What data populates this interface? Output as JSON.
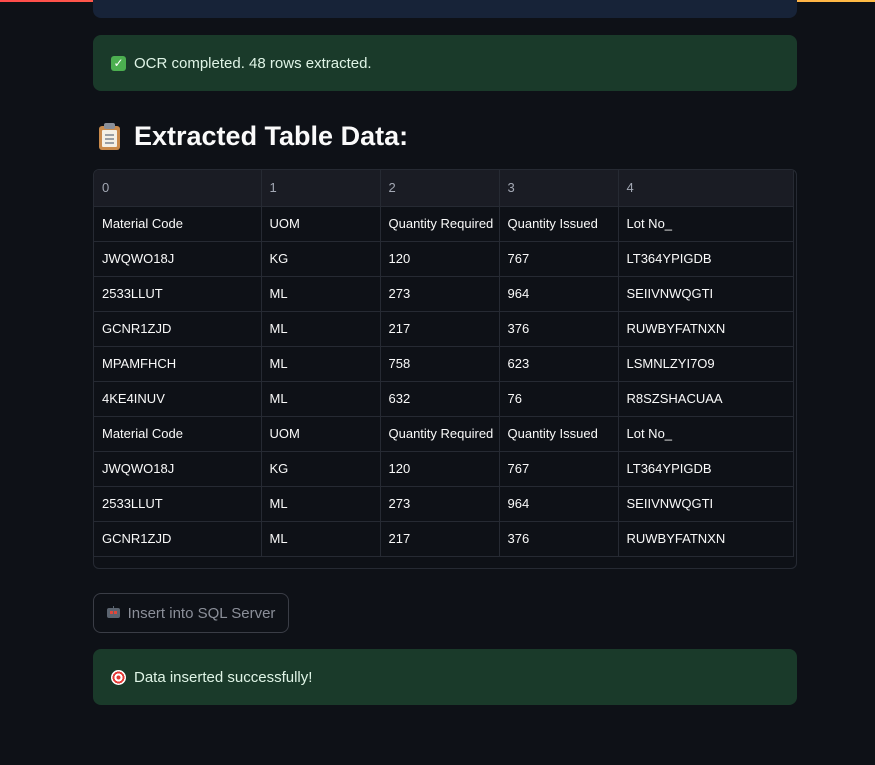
{
  "alerts": {
    "ocr_message": "OCR completed. 48 rows extracted.",
    "ocr_icon": "check-box-icon",
    "insert_message": "Data inserted successfully!",
    "insert_icon": "direct-hit-icon"
  },
  "heading": {
    "title": "Extracted Table Data:",
    "icon": "clipboard-icon"
  },
  "table": {
    "columns": [
      "0",
      "1",
      "2",
      "3",
      "4"
    ],
    "rows": [
      [
        "Material Code",
        "UOM",
        "Quantity Required",
        "Quantity Issued",
        "Lot No_"
      ],
      [
        "JWQWO18J",
        "KG",
        "120",
        "767",
        "LT364YPIGDB"
      ],
      [
        "2533LLUT",
        "ML",
        "273",
        "964",
        "SEIIVNWQGTI"
      ],
      [
        "GCNR1ZJD",
        "ML",
        "217",
        "376",
        "RUWBYFATNXN"
      ],
      [
        "MPAMFHCH",
        "ML",
        "758",
        "623",
        "LSMNLZYI7O9"
      ],
      [
        "4KE4INUV",
        "ML",
        "632",
        "76",
        "R8SZSHACUAA"
      ],
      [
        "Material Code",
        "UOM",
        "Quantity Required",
        "Quantity Issued",
        "Lot No_"
      ],
      [
        "JWQWO18J",
        "KG",
        "120",
        "767",
        "LT364YPIGDB"
      ],
      [
        "2533LLUT",
        "ML",
        "273",
        "964",
        "SEIIVNWQGTI"
      ],
      [
        "GCNR1ZJD",
        "ML",
        "217",
        "376",
        "RUWBYFATNXN"
      ]
    ]
  },
  "actions": {
    "insert_button_label": "Insert into SQL Server",
    "insert_button_icon": "robot-icon"
  },
  "colors": {
    "success_bg": "#1a3a2a",
    "app_bg": "#0e1117",
    "accent": "#ff4b4b"
  }
}
